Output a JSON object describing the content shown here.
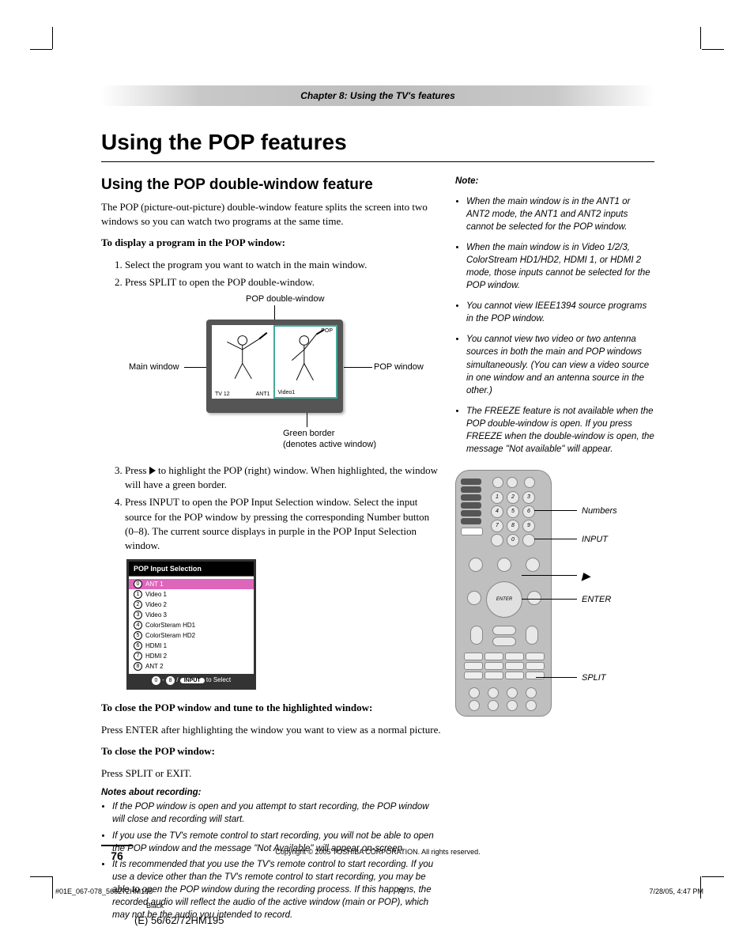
{
  "chapter_bar": "Chapter 8: Using the TV's features",
  "title": "Using the POP features",
  "subtitle": "Using the POP double-window feature",
  "intro": "The POP (picture-out-picture) double-window feature splits the screen into two windows so you can watch two programs at the same time.",
  "display_heading": "To display a program in the POP window:",
  "steps_12": [
    "Select the program you want to watch in the main window.",
    "Press SPLIT to open the POP double-window."
  ],
  "diag": {
    "top": "POP double-window",
    "main": "Main window",
    "pop": "POP window",
    "border1": "Green border",
    "border2": "(denotes active window)",
    "ant1": "ANT1",
    "tv12": "TV 12",
    "popsmall": "POP",
    "video1": "Video1"
  },
  "step3_a": "Press ",
  "step3_b": " to highlight the POP (right) window. When highlighted, the window will have a green border.",
  "step4": "Press INPUT to open the POP Input Selection window. Select the input source for the POP window by pressing the corresponding Number button (0–8). The current source displays in purple in the POP Input Selection window.",
  "popmenu": {
    "title": "POP Input Selection",
    "items": [
      "ANT 1",
      "Video 1",
      "Video 2",
      "Video 3",
      "ColorSteram HD1",
      "ColorSteram HD2",
      "HDMI 1",
      "HDMI 2",
      "ANT 2"
    ],
    "footer_sep": " - ",
    "footer_slash": " / ",
    "footer_input": "INPUT",
    "footer_tail": " to Select"
  },
  "close_tune_h": "To close the POP window and tune to the highlighted window:",
  "close_tune_p": "Press ENTER after highlighting the window you want to view as a normal picture.",
  "close_pop_h": "To close the POP window:",
  "close_pop_p": "Press SPLIT or EXIT.",
  "notes_rec_h": "Notes about recording:",
  "notes_rec": [
    "If the POP window is open and you attempt to start recording, the POP window will close and recording will start.",
    "If you use the TV's remote control to start recording, you will not be able to open the POP window and the message \"Not Available\" will appear on-screen.",
    "It is recommended that you use the TV's remote control to start recording. If you use a device other than the TV's remote control to start recording, you may be able to open the POP window during the recording process. If this happens, the recorded audio will reflect the audio of the active window (main or POP), which may not be the audio you intended to record."
  ],
  "right_note_h": "Note:",
  "right_notes": [
    "When the main window is in the ANT1 or ANT2 mode, the ANT1 and ANT2 inputs cannot be selected for the POP window.",
    "When the main window is in Video 1/2/3, ColorStream HD1/HD2, HDMI 1, or HDMI 2 mode, those inputs cannot be selected for the POP window.",
    "You cannot view IEEE1394 source programs in the POP window.",
    "You cannot view two video or two antenna sources in both the main and POP windows simultaneously. (You can view a video source in one window and an antenna source in the other.)",
    "The FREEZE feature is not available when the POP double-window is open. If you press FREEZE when the double-window is open, the message \"Not available\" will appear."
  ],
  "remote_labels": {
    "numbers": "Numbers",
    "input": "INPUT",
    "right": "▶",
    "enter": "ENTER",
    "split": "SPLIT"
  },
  "page_number": "76",
  "copyright": "Copyright © 2005 TOSHIBA CORPORATION. All rights reserved.",
  "meta": {
    "file": "#01E_067-078_566272HM195",
    "page": "76",
    "datetime": "7/28/05, 4:47 PM",
    "black": "Black",
    "model": "(E) 56/62/72HM195"
  }
}
